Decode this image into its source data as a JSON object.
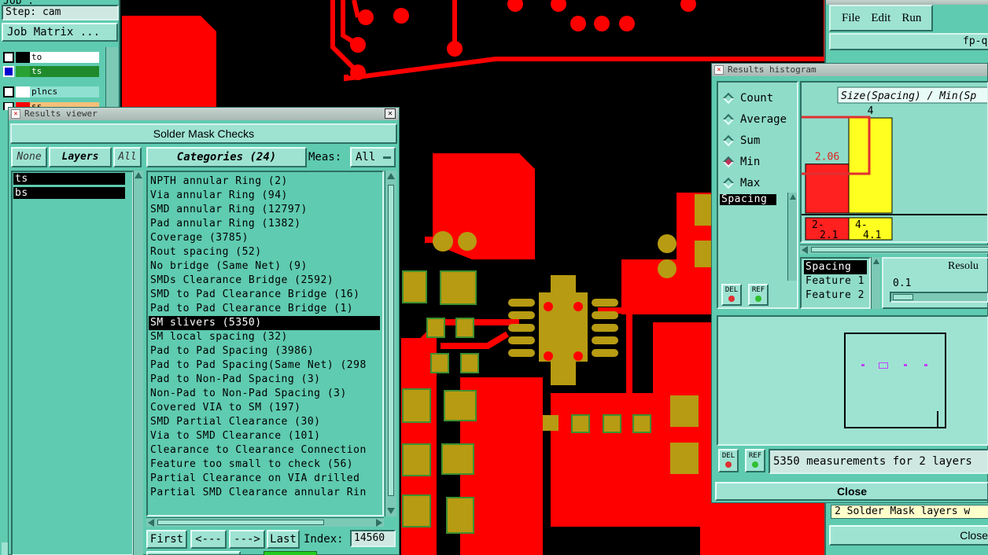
{
  "left_panel": {
    "job_label": "Job : ",
    "step_label": "Step: cam",
    "job_matrix_button": "Job Matrix ...",
    "layers": [
      {
        "name": "to",
        "color": "#000000",
        "bg": "#ffffff"
      },
      {
        "name": "ts",
        "color": "#2aa135",
        "bg": "#1f8a2b"
      },
      {
        "name": "plncs",
        "color": "#ffffff",
        "bg": "#8fe0d0"
      },
      {
        "name": "ss",
        "color": "#ff0000",
        "bg": "#f4c07a"
      }
    ]
  },
  "results_viewer": {
    "title": "Results viewer",
    "header": "Solder Mask Checks",
    "none_button": "None",
    "layers_button": "Layers",
    "all_button": "All",
    "layer_items": [
      "ts",
      "bs"
    ],
    "categories_button": "Categories (24)",
    "meas_label": "Meas:",
    "meas_value": "All",
    "categories": [
      "NPTH annular Ring (2)",
      "Via annular Ring (94)",
      "SMD annular Ring (12797)",
      "Pad annular Ring (1382)",
      "Coverage (3785)",
      "Rout spacing (52)",
      "No bridge (Same Net) (9)",
      "SMDs Clearance Bridge (2592)",
      "SMD to Pad Clearance Bridge (16)",
      "Pad to Pad Clearance Bridge (1)",
      "SM slivers (5350)",
      "SM local spacing (32)",
      "Pad to Pad Spacing (3986)",
      "Pad to Pad Spacing(Same Net) (298",
      "Pad to Non-Pad Spacing (3)",
      "Non-Pad to Non-Pad Spacing (3)",
      "Covered VIA to SM (197)",
      "SMD Partial Clearance (30)",
      "Via to SMD Clearance (101)",
      "Clearance to Clearance Connection",
      "Feature too small to check (56)",
      "Partial Clearance on VIA drilled",
      "Partial SMD Clearance annular Rin"
    ],
    "selected_index": 10,
    "first_button": "First",
    "prev_button": "<---",
    "next_button": "--->",
    "last_button": "Last",
    "index_label": "Index:",
    "index_value": "14560"
  },
  "histogram": {
    "title": "Results histogram",
    "options": [
      "Count",
      "Average",
      "Sum",
      "Min",
      "Max"
    ],
    "selected_option": "Min",
    "spacing_item": "Spacing",
    "chart_title": "Size(Spacing) / Min(Sp",
    "del_label": "DEL",
    "ref_label": "REF",
    "attr_items": [
      "Spacing",
      "Feature 1",
      "Feature 2"
    ],
    "resolution_label": "Resolu",
    "resolution_value": "0.1",
    "measurements_text": "5350 measurements for 2 layers",
    "close_button": "Close"
  },
  "chart_data": {
    "type": "bar",
    "title": "Size(Spacing) / Min(Sp",
    "categories": [
      "2-2.1",
      "4-4.1"
    ],
    "values": [
      2.06,
      4
    ],
    "data_labels": [
      "2.06",
      "4"
    ],
    "bar_colors": [
      "#ff2020",
      "#ffff20"
    ],
    "tick_labels": [
      [
        "2-",
        "2.1"
      ],
      [
        "4-",
        "4.1"
      ]
    ]
  },
  "back_window": {
    "menu": [
      "File",
      "Edit",
      "Run"
    ],
    "subtitle": "fp-qa",
    "message": "2 Solder Mask layers w",
    "close_button": "Close"
  },
  "colors": {
    "board_copper": "#ff0000",
    "pad": "#b79b12",
    "panel": "#5fcbb0",
    "panel_light": "#9ee3d2"
  }
}
